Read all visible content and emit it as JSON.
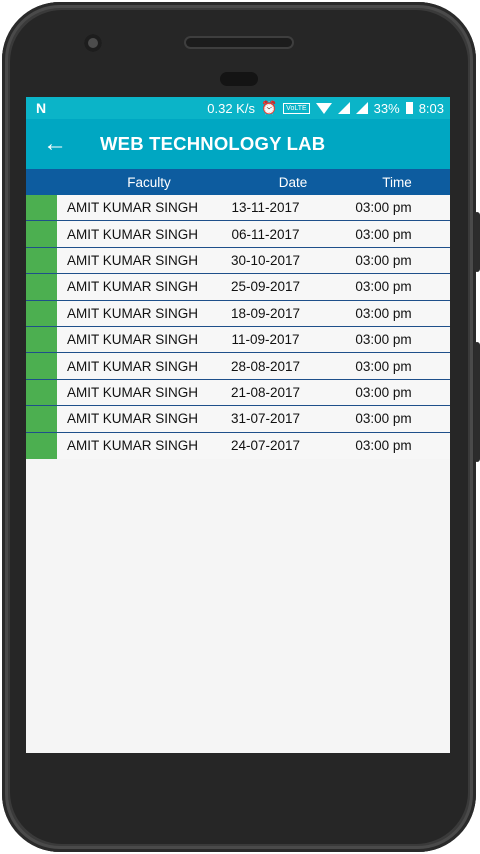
{
  "status": {
    "speed": "0.32 K/s",
    "volte": "VoLTE",
    "battery": "33%",
    "time": "8:03"
  },
  "appbar": {
    "title": "WEB TECHNOLOGY LAB",
    "back": "←"
  },
  "table": {
    "headers": [
      "Faculty",
      "Date",
      "Time"
    ],
    "rows": [
      [
        "AMIT KUMAR SINGH",
        "13-11-2017",
        "03:00 pm"
      ],
      [
        "AMIT KUMAR SINGH",
        "06-11-2017",
        "03:00 pm"
      ],
      [
        "AMIT KUMAR SINGH",
        "30-10-2017",
        "03:00 pm"
      ],
      [
        "AMIT KUMAR SINGH",
        "25-09-2017",
        "03:00 pm"
      ],
      [
        "AMIT KUMAR SINGH",
        "18-09-2017",
        "03:00 pm"
      ],
      [
        "AMIT KUMAR SINGH",
        "11-09-2017",
        "03:00 pm"
      ],
      [
        "AMIT KUMAR SINGH",
        "28-08-2017",
        "03:00 pm"
      ],
      [
        "AMIT KUMAR SINGH",
        "21-08-2017",
        "03:00 pm"
      ],
      [
        "AMIT KUMAR SINGH",
        "31-07-2017",
        "03:00 pm"
      ],
      [
        "AMIT KUMAR SINGH",
        "24-07-2017",
        "03:00 pm"
      ]
    ]
  },
  "colors": {
    "statusbar": "#0bb4c8",
    "appbar": "#00a7c2",
    "header": "#0d5c9f",
    "row_marker": "#4caf50"
  }
}
